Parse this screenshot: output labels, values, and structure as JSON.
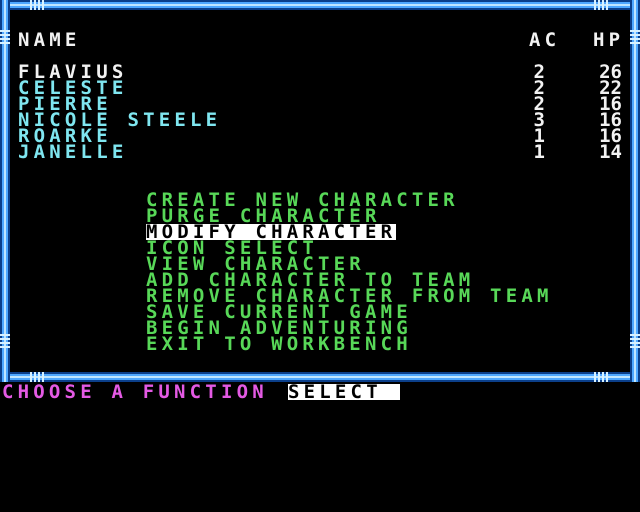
{
  "roster": {
    "header": {
      "name": "NAME",
      "ac": "AC",
      "hp": "HP"
    },
    "characters": [
      {
        "name": "FLAVIUS",
        "ac": "2",
        "hp": "26",
        "color": "#f2f2f2"
      },
      {
        "name": "CELESTE",
        "ac": "2",
        "hp": "22",
        "color": "#7fe6f0"
      },
      {
        "name": "PIERRE",
        "ac": "2",
        "hp": "16",
        "color": "#7fe6f0"
      },
      {
        "name": "NICOLE STEELE",
        "ac": "3",
        "hp": "16",
        "color": "#7fe6f0"
      },
      {
        "name": "ROARKE",
        "ac": "1",
        "hp": "16",
        "color": "#7fe6f0"
      },
      {
        "name": "JANELLE",
        "ac": "1",
        "hp": "14",
        "color": "#7fe6f0"
      }
    ]
  },
  "menu": {
    "items": [
      "CREATE NEW CHARACTER",
      "PURGE CHARACTER",
      "MODIFY CHARACTER",
      "ICON SELECT",
      "VIEW CHARACTER",
      "ADD CHARACTER TO TEAM",
      "REMOVE CHARACTER FROM TEAM",
      "SAVE CURRENT GAME",
      "BEGIN ADVENTURING",
      "EXIT TO WORKBENCH"
    ],
    "selected_index": 2
  },
  "prompt": {
    "label": "CHOOSE A FUNCTION",
    "input_value": "SELECT"
  },
  "colors": {
    "frame": "#4fa8ff",
    "menu": "#58d858",
    "prompt": "#e45ae4"
  }
}
